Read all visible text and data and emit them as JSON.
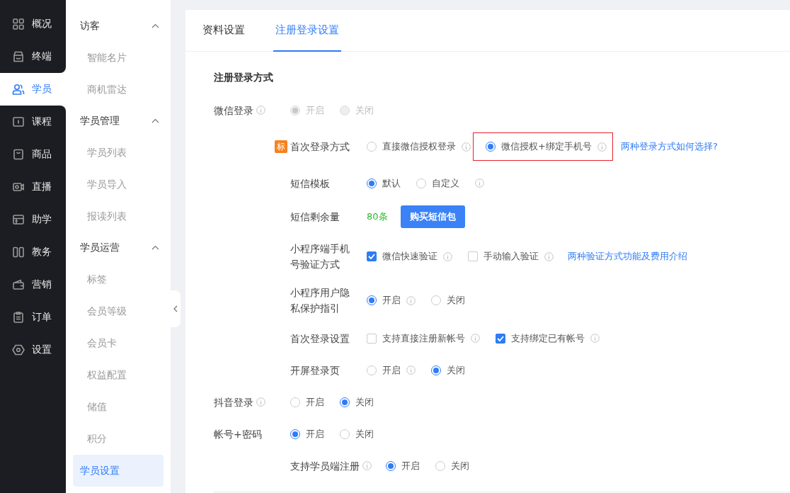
{
  "nav": [
    {
      "label": "概况",
      "selected": false
    },
    {
      "label": "终端",
      "selected": false
    },
    {
      "label": "学员",
      "selected": true
    },
    {
      "label": "课程",
      "selected": false
    },
    {
      "label": "商品",
      "selected": false
    },
    {
      "label": "直播",
      "selected": false
    },
    {
      "label": "助学",
      "selected": false
    },
    {
      "label": "教务",
      "selected": false
    },
    {
      "label": "营销",
      "selected": false
    },
    {
      "label": "订单",
      "selected": false
    },
    {
      "label": "设置",
      "selected": false
    }
  ],
  "subnav": [
    {
      "title": "访客",
      "expanded": true,
      "items": [
        {
          "label": "智能名片",
          "selected": false
        },
        {
          "label": "商机雷达",
          "selected": false
        }
      ]
    },
    {
      "title": "学员管理",
      "expanded": true,
      "items": [
        {
          "label": "学员列表",
          "selected": false
        },
        {
          "label": "学员导入",
          "selected": false
        },
        {
          "label": "报读列表",
          "selected": false
        }
      ]
    },
    {
      "title": "学员运营",
      "expanded": true,
      "items": [
        {
          "label": "标签",
          "selected": false
        },
        {
          "label": "会员等级",
          "selected": false
        },
        {
          "label": "会员卡",
          "selected": false
        },
        {
          "label": "权益配置",
          "selected": false
        },
        {
          "label": "储值",
          "selected": false
        },
        {
          "label": "积分",
          "selected": false
        },
        {
          "label": "学员设置",
          "selected": true
        }
      ]
    }
  ],
  "tabs": [
    {
      "label": "资料设置",
      "selected": false
    },
    {
      "label": "注册登录设置",
      "selected": true
    }
  ],
  "section_title": "注册登录方式",
  "rows": [
    {
      "label": "微信登录",
      "info": true,
      "kind": "radio",
      "disabled": true,
      "options": [
        {
          "label": "开启",
          "selected": true
        },
        {
          "label": "关闭",
          "selected": false
        }
      ],
      "children": [
        {
          "label": "首次登录方式",
          "badge": "标",
          "kind": "radio",
          "options": [
            {
              "label": "直接微信授权登录",
              "selected": false,
              "info": true
            },
            {
              "label": "微信授权+绑定手机号",
              "selected": true,
              "info": true,
              "highlighted": true
            }
          ],
          "link": "两种登录方式如何选择?"
        },
        {
          "label": "短信模板",
          "kind": "radio",
          "options": [
            {
              "label": "默认",
              "selected": true
            },
            {
              "label": "自定义",
              "selected": false
            }
          ],
          "trailing_info": true
        },
        {
          "label": "短信剩余量",
          "kind": "count",
          "value": "80条",
          "button": "购买短信包"
        },
        {
          "label": "小程序端手机号验证方式",
          "kind": "checkbox",
          "options": [
            {
              "label": "微信快速验证",
              "checked": true,
              "info": true
            },
            {
              "label": "手动输入验证",
              "checked": false,
              "info": true
            }
          ],
          "link": "两种验证方式功能及费用介绍"
        },
        {
          "label": "小程序用户隐私保护指引",
          "kind": "radio",
          "options": [
            {
              "label": "开启",
              "selected": true,
              "info": true
            },
            {
              "label": "关闭",
              "selected": false
            }
          ]
        },
        {
          "label": "首次登录设置",
          "kind": "checkbox",
          "options": [
            {
              "label": "支持直接注册新帐号",
              "checked": false,
              "info": true
            },
            {
              "label": "支持绑定已有帐号",
              "checked": true,
              "info": true
            }
          ]
        },
        {
          "label": "开屏登录页",
          "kind": "radio",
          "options": [
            {
              "label": "开启",
              "selected": false,
              "info": true
            },
            {
              "label": "关闭",
              "selected": true
            }
          ]
        }
      ]
    },
    {
      "label": "抖音登录",
      "info": true,
      "kind": "radio",
      "options": [
        {
          "label": "开启",
          "selected": false
        },
        {
          "label": "关闭",
          "selected": true
        }
      ]
    },
    {
      "label": "帐号+密码",
      "kind": "radio",
      "options": [
        {
          "label": "开启",
          "selected": true
        },
        {
          "label": "关闭",
          "selected": false
        }
      ],
      "children": [
        {
          "label": "支持学员端注册",
          "info": true,
          "kind": "radio",
          "options": [
            {
              "label": "开启",
              "selected": true
            },
            {
              "label": "关闭",
              "selected": false
            }
          ]
        }
      ]
    }
  ]
}
